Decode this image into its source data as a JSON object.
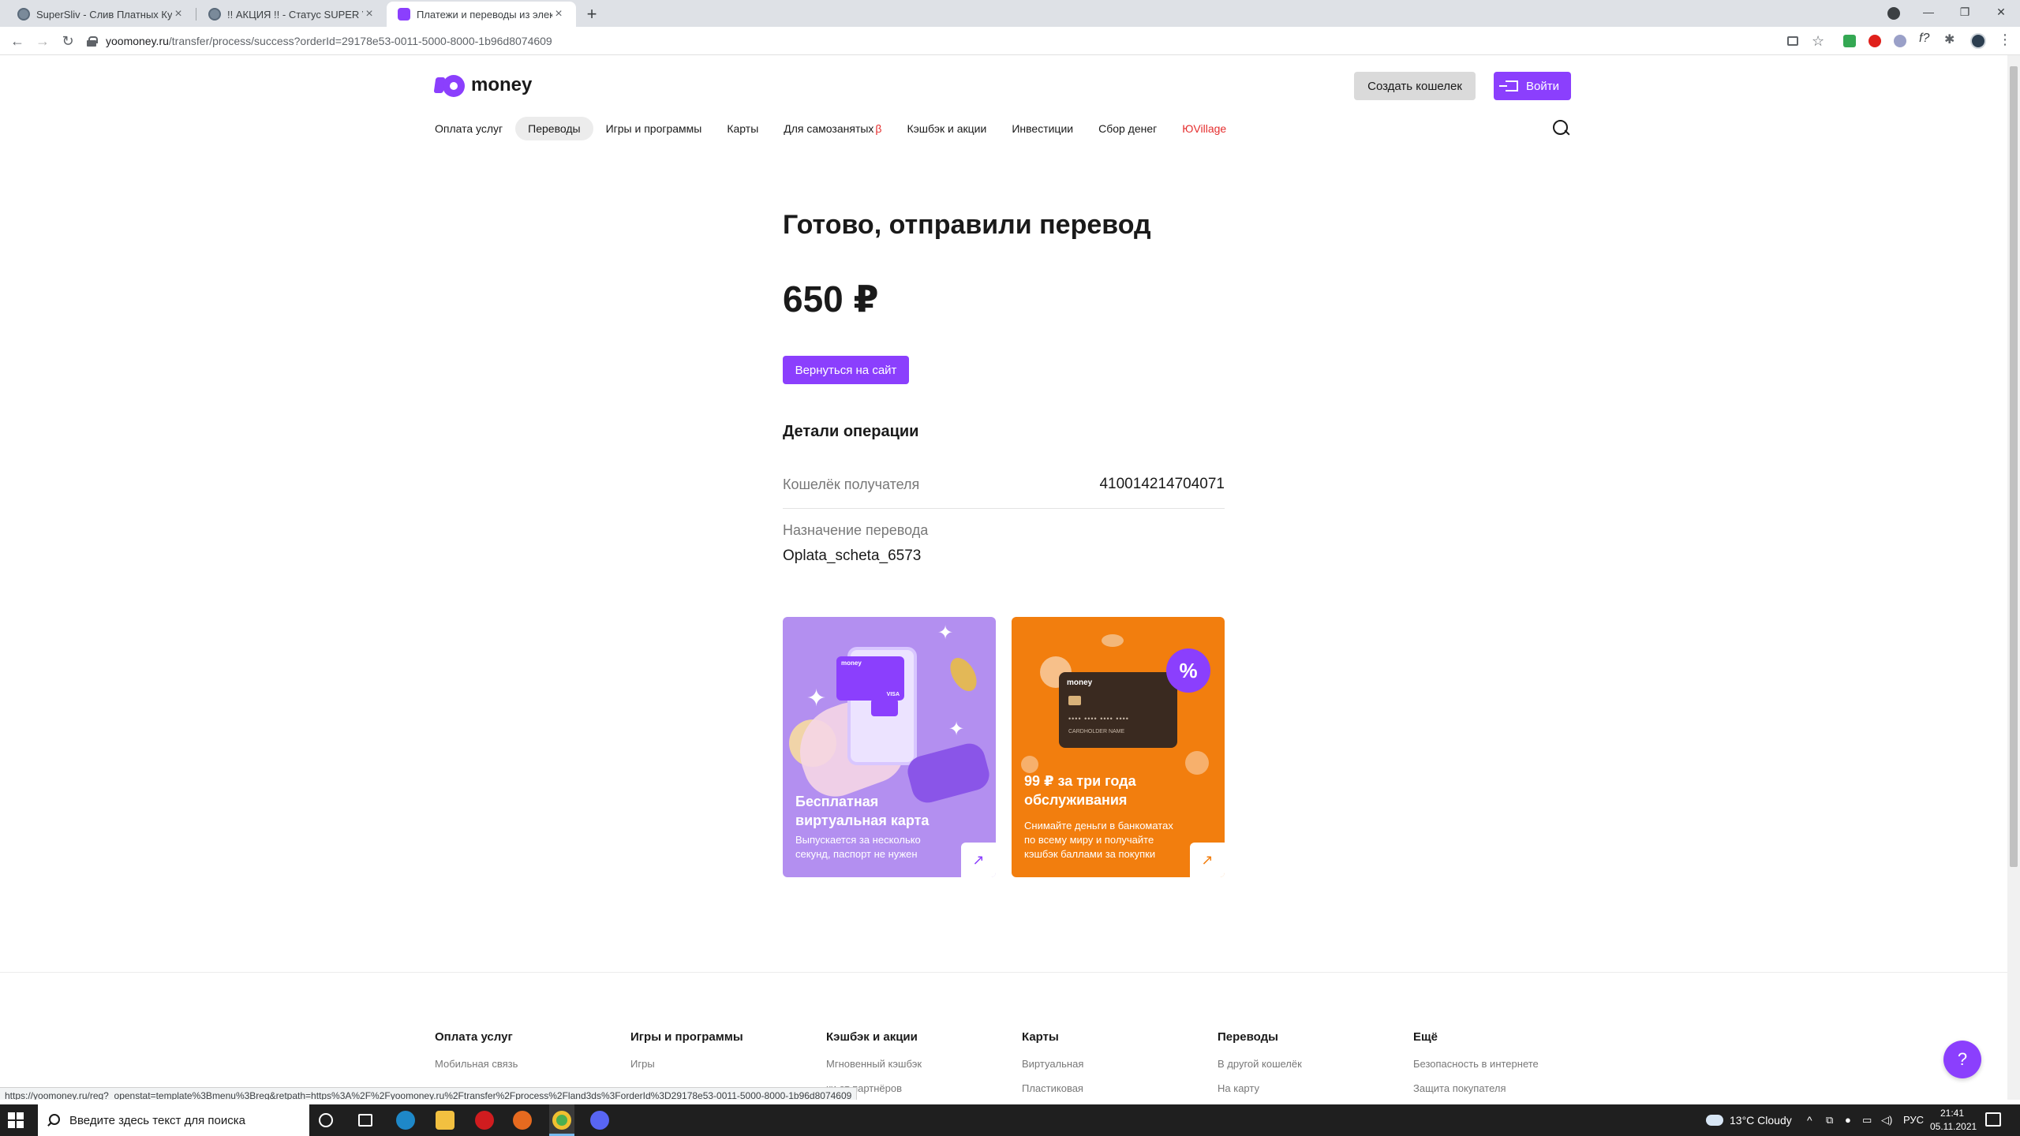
{
  "browser": {
    "tabs": [
      {
        "title": "SuperSliv - Слив Платных Курсов"
      },
      {
        "title": "!! АКЦИЯ !! - Статус SUPER VIP"
      },
      {
        "title": "Платежи и переводы из электр"
      }
    ],
    "url_host": "yoomoney.ru",
    "url_path": "/transfer/process/success?orderId=29178e53-0011-5000-8000-1b96d8074609"
  },
  "header": {
    "logo_text": "money",
    "create_wallet": "Создать кошелек",
    "login": "Войти"
  },
  "nav": {
    "items": [
      "Оплата услуг",
      "Переводы",
      "Игры и программы",
      "Карты",
      "Для самозанятых",
      "Кэшбэк и акции",
      "Инвестиции",
      "Сбор денег",
      "ЮVillage"
    ],
    "beta_mark": "β",
    "active": "Переводы"
  },
  "main": {
    "title": "Готово, отправили перевод",
    "amount": "650 ₽",
    "back_button": "Вернуться на сайт",
    "details_title": "Детали операции",
    "wallet_label": "Кошелёк получателя",
    "wallet_value": "410014214704071",
    "purpose_label": "Назначение перевода",
    "purpose_value": "Oplata_scheta_6573"
  },
  "promos": [
    {
      "title_l1": "Бесплатная",
      "title_l2": "виртуальная карта",
      "sub_l1": "Выпускается за несколько",
      "sub_l2": "секунд, паспорт не нужен",
      "card_logo": "money",
      "card_brand": "VISA"
    },
    {
      "title_l1": "99 ₽ за три года",
      "title_l2": "обслуживания",
      "sub_l1": "Снимайте деньги в банкоматах",
      "sub_l2": "по всему миру и получайте",
      "sub_l3": "кэшбэк баллами за покупки",
      "badge": "%",
      "card_logo": "money",
      "card_name": "CARDHOLDER NAME"
    }
  ],
  "footer": {
    "columns": [
      {
        "head": "Оплата услуг",
        "links": [
          "Мобильная связь",
          ""
        ]
      },
      {
        "head": "Игры и программы",
        "links": [
          "Игры",
          ""
        ]
      },
      {
        "head": "Кэшбэк и акции",
        "links": [
          "Мгновенный кэшбэк",
          "ки от партнёров"
        ]
      },
      {
        "head": "Карты",
        "links": [
          "Виртуальная",
          "Пластиковая"
        ]
      },
      {
        "head": "Переводы",
        "links": [
          "В другой кошелёк",
          "На карту"
        ]
      },
      {
        "head": "Ещё",
        "links": [
          "Безопасность в интернете",
          "Защита покупателя"
        ]
      }
    ],
    "help": "?"
  },
  "status_bar": "https://yoomoney.ru/reg?_openstat=template%3Bmenu%3Breg&retpath=https%3A%2F%2Fyoomoney.ru%2Ftransfer%2Fprocess%2Fland3ds%3ForderId%3D29178e53-0011-5000-8000-1b96d8074609",
  "taskbar": {
    "search_placeholder": "Введите здесь текст для поиска",
    "weather": "13°C  Cloudy",
    "lang": "РУС",
    "time": "21:41",
    "date": "05.11.2021"
  },
  "colors": {
    "brand": "#8b3ffd",
    "orange": "#f27e0e",
    "lilac": "#b38ff0",
    "red": "#e52e2e"
  }
}
